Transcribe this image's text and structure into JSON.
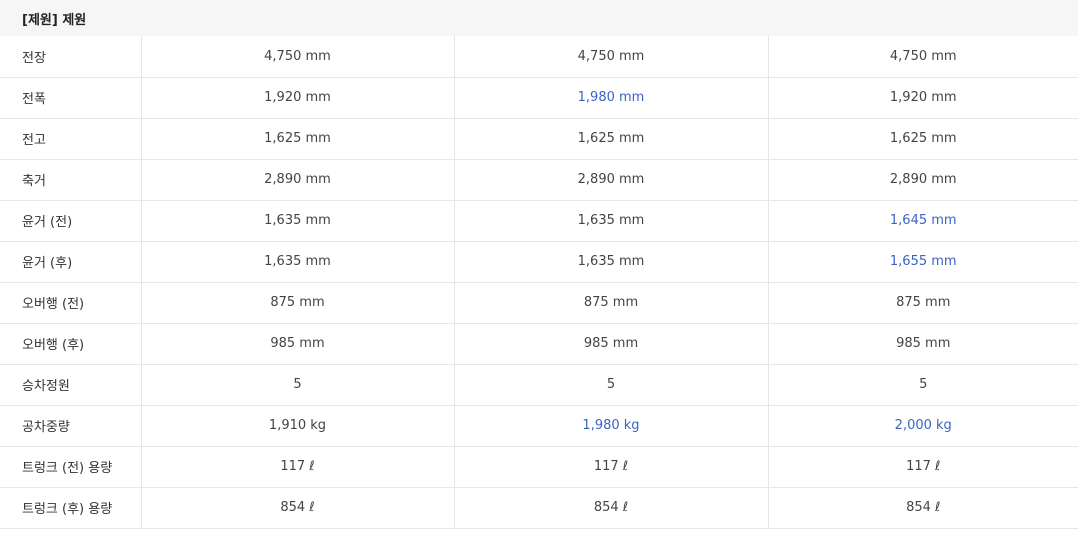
{
  "section": {
    "title": "[제원] 제원"
  },
  "colors": {
    "highlight": "#3b63c4",
    "text": "#444444",
    "header_bg": "#f6f6f6",
    "border": "#e6e6e6"
  },
  "rows": [
    {
      "label": "전장",
      "values": [
        "4,750 mm",
        "4,750 mm",
        "4,750 mm"
      ],
      "highlight": [
        false,
        false,
        false
      ]
    },
    {
      "label": "전폭",
      "values": [
        "1,920 mm",
        "1,980 mm",
        "1,920 mm"
      ],
      "highlight": [
        false,
        true,
        false
      ]
    },
    {
      "label": "전고",
      "values": [
        "1,625 mm",
        "1,625 mm",
        "1,625 mm"
      ],
      "highlight": [
        false,
        false,
        false
      ]
    },
    {
      "label": "축거",
      "values": [
        "2,890 mm",
        "2,890 mm",
        "2,890 mm"
      ],
      "highlight": [
        false,
        false,
        false
      ]
    },
    {
      "label": "윤거 (전)",
      "values": [
        "1,635 mm",
        "1,635 mm",
        "1,645 mm"
      ],
      "highlight": [
        false,
        false,
        true
      ]
    },
    {
      "label": "윤거 (후)",
      "values": [
        "1,635 mm",
        "1,635 mm",
        "1,655 mm"
      ],
      "highlight": [
        false,
        false,
        true
      ]
    },
    {
      "label": "오버행 (전)",
      "values": [
        "875 mm",
        "875 mm",
        "875 mm"
      ],
      "highlight": [
        false,
        false,
        false
      ]
    },
    {
      "label": "오버행 (후)",
      "values": [
        "985 mm",
        "985 mm",
        "985 mm"
      ],
      "highlight": [
        false,
        false,
        false
      ]
    },
    {
      "label": "승차정원",
      "values": [
        "5",
        "5",
        "5"
      ],
      "highlight": [
        false,
        false,
        false
      ]
    },
    {
      "label": "공차중량",
      "values": [
        "1,910 kg",
        "1,980 kg",
        "2,000 kg"
      ],
      "highlight": [
        false,
        true,
        true
      ]
    },
    {
      "label": "트렁크 (전) 용량",
      "values": [
        "117 ℓ",
        "117 ℓ",
        "117 ℓ"
      ],
      "highlight": [
        false,
        false,
        false
      ]
    },
    {
      "label": "트렁크 (후) 용량",
      "values": [
        "854 ℓ",
        "854 ℓ",
        "854 ℓ"
      ],
      "highlight": [
        false,
        false,
        false
      ]
    }
  ]
}
